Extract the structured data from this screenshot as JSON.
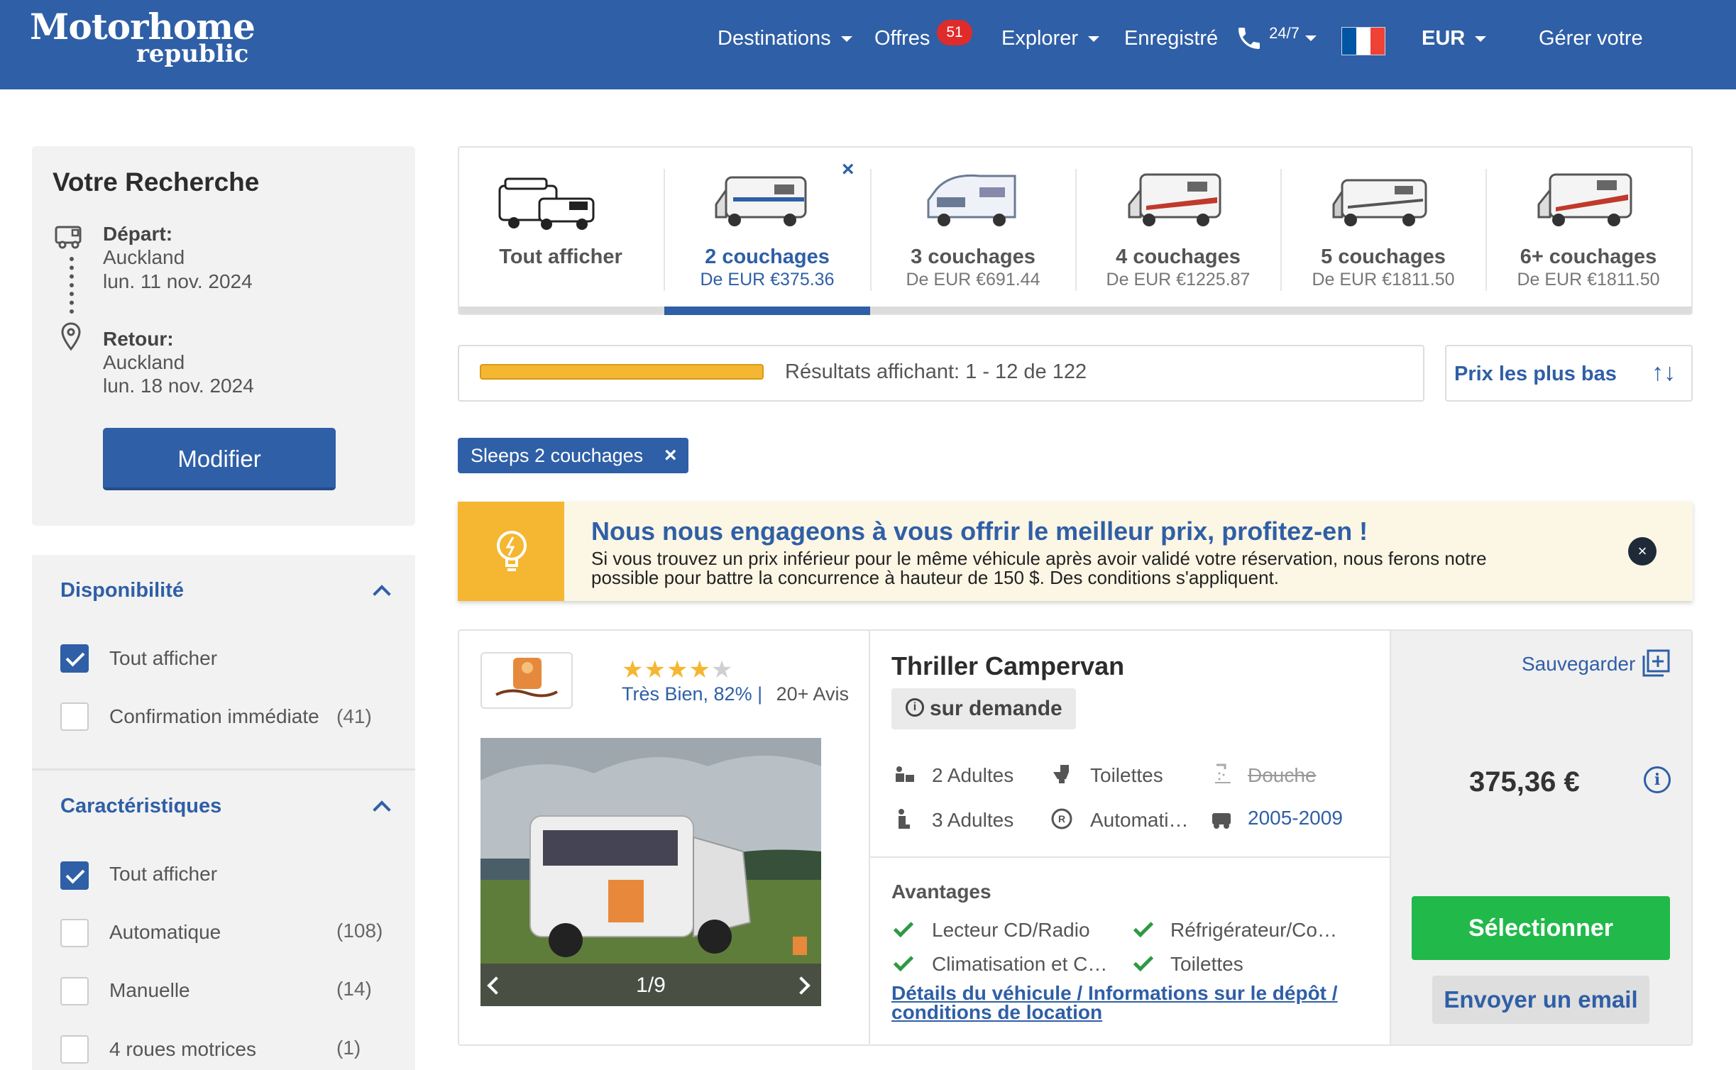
{
  "header": {
    "logo_line1": "Motorhome",
    "logo_line2": "republic",
    "nav": {
      "destinations": "Destinations",
      "offers": "Offres",
      "offers_badge": "51",
      "explore": "Explorer",
      "saved": "Enregistré",
      "support": "24/7",
      "currency": "EUR",
      "manage": "Gérer votre"
    },
    "flag_colors": [
      "#0055A4",
      "#FFFFFF",
      "#EF4135"
    ]
  },
  "search": {
    "title": "Votre Recherche",
    "departure_label": "Départ:",
    "departure_city": "Auckland",
    "departure_date": "lun. 11 nov. 2024",
    "return_label": "Retour:",
    "return_city": "Auckland",
    "return_date": "lun. 18 nov. 2024",
    "modify_button": "Modifier"
  },
  "filters": {
    "availability": {
      "title": "Disponibilité",
      "options": [
        {
          "label": "Tout afficher",
          "count": "",
          "checked": true
        },
        {
          "label": "Confirmation immédiate",
          "count": "(41)",
          "checked": false
        }
      ]
    },
    "features": {
      "title": "Caractéristiques",
      "options": [
        {
          "label": "Tout afficher",
          "count": "",
          "checked": true
        },
        {
          "label": "Automatique",
          "count": "(108)",
          "checked": false
        },
        {
          "label": "Manuelle",
          "count": "(14)",
          "checked": false
        },
        {
          "label": "4 roues motrices",
          "count": "(1)",
          "checked": false
        }
      ]
    }
  },
  "tabs": [
    {
      "title": "Tout afficher",
      "price": ""
    },
    {
      "title": "2 couchages",
      "price": "De EUR €375.36",
      "active": true
    },
    {
      "title": "3 couchages",
      "price": "De EUR €691.44"
    },
    {
      "title": "4 couchages",
      "price": "De EUR €1225.87"
    },
    {
      "title": "5 couchages",
      "price": "De EUR €1811.50"
    },
    {
      "title": "6+ couchages",
      "price": "De EUR €1811.50"
    }
  ],
  "tab_close": "×",
  "results": {
    "text": "Résultats affichant: 1 - 12 de 122",
    "progress": 1.0,
    "sort_label": "Prix les plus bas",
    "sort_icon": "↑↓"
  },
  "active_filter_chip": {
    "label": "Sleeps 2 couchages",
    "close": "×"
  },
  "promo": {
    "title": "Nous nous engageons à vous offrir le meilleur prix, profitez-en !",
    "body_line1": "Si vous trouvez un prix inférieur pour le même véhicule après avoir validé votre réservation, nous ferons notre",
    "body_line2": "possible pour battre la concurrence à hauteur de 150 $. Des conditions s'appliquent.",
    "close": "×",
    "icon": "lightbulb-icon"
  },
  "listing": {
    "stars": "★★★★",
    "star_empty": "★",
    "rating_text": "Très Bien, 82% |",
    "reviews": "20+ Avis",
    "photo_counter": "1/9",
    "vehicle_name": "Thriller Campervan",
    "availability": "sur demande",
    "specs": {
      "adults_seat": "2 Adultes",
      "toilet": "Toilettes",
      "shower": "Douche",
      "adults_travel": "3 Adultes",
      "transmission": "Automati…",
      "years": "2005-2009"
    },
    "benefits_title": "Avantages",
    "benefits": [
      "Lecteur CD/Radio",
      "Réfrigérateur/Co…",
      "Climatisation et C…",
      "Toilettes"
    ],
    "details_link_line1": "Détails du véhicule / Informations sur le dépôt /",
    "details_link_line2": "conditions de location",
    "save_label": "Sauvegarder",
    "price": "375,36 €",
    "info": "i",
    "select_button": "Sélectionner",
    "email_button": "Envoyer un email"
  }
}
